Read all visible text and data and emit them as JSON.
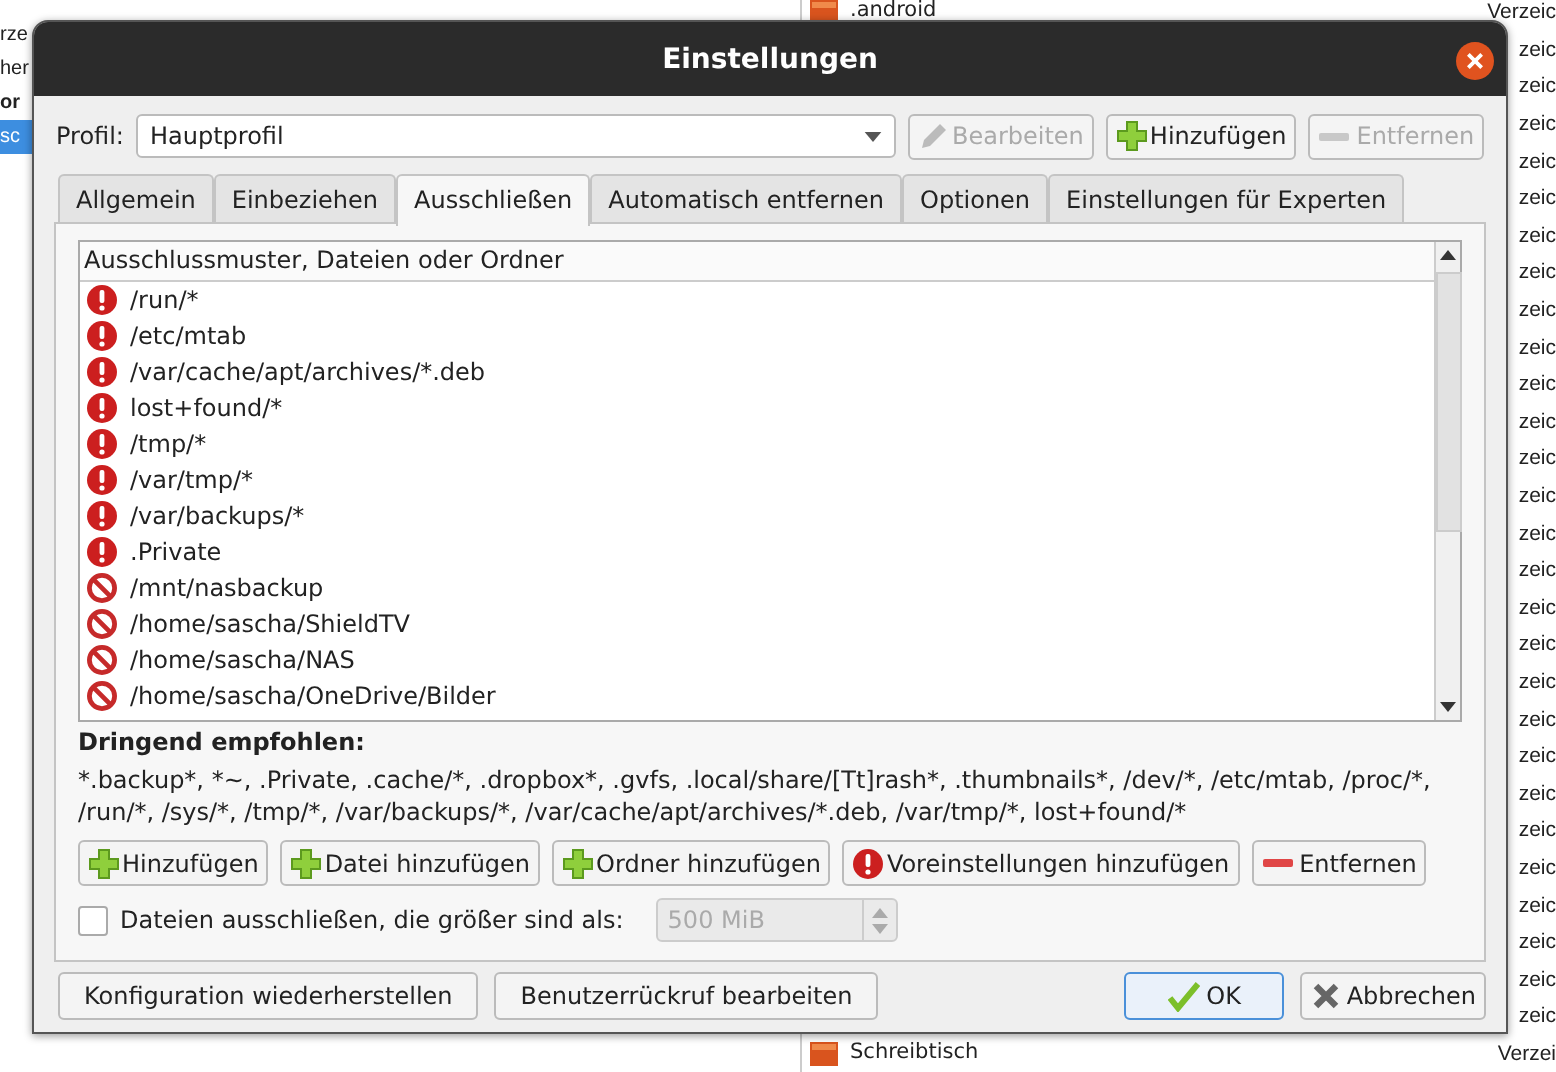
{
  "background": {
    "left_items": [
      {
        "label": "rze",
        "selected": false,
        "bold": false
      },
      {
        "label": "her",
        "selected": false,
        "bold": false
      },
      {
        "label": "or",
        "selected": false,
        "bold": true
      },
      {
        "label": "sc",
        "selected": true,
        "bold": false
      }
    ],
    "rows": [
      {
        "name": ".android",
        "type": "Verzeic"
      },
      {
        "type": "zeic"
      },
      {
        "type": "zeic"
      },
      {
        "type": "zeic"
      },
      {
        "type": "zeic"
      },
      {
        "type": "zeic"
      },
      {
        "type": "zeic"
      },
      {
        "type": "zeic"
      },
      {
        "type": "zeic"
      },
      {
        "type": "zeic"
      },
      {
        "type": "zeic"
      },
      {
        "type": "zeic"
      },
      {
        "type": "zeic"
      },
      {
        "type": "zeic"
      },
      {
        "type": "zeic"
      },
      {
        "type": "zeic"
      },
      {
        "type": "zeic"
      },
      {
        "type": "zeic"
      },
      {
        "type": "zeic"
      },
      {
        "type": "zeic"
      },
      {
        "type": "zeic"
      },
      {
        "type": "zeic"
      },
      {
        "type": "zeic"
      },
      {
        "type": "zeic"
      },
      {
        "type": "zeic"
      },
      {
        "type": "zeic"
      },
      {
        "type": "zeic"
      },
      {
        "type": "zeic"
      },
      {
        "name": "Schreibtisch",
        "type": "Verzei"
      }
    ]
  },
  "window": {
    "title": "Einstellungen"
  },
  "profile": {
    "label": "Profil:",
    "value": "Hauptprofil",
    "buttons": [
      {
        "label": "Bearbeiten",
        "kind": "edit",
        "disabled": true
      },
      {
        "label": "Hinzufügen",
        "kind": "add",
        "disabled": false
      },
      {
        "label": "Entfernen",
        "kind": "remove",
        "disabled": true
      }
    ]
  },
  "tabs": [
    {
      "label": "Allgemein",
      "selected": false
    },
    {
      "label": "Einbeziehen",
      "selected": false
    },
    {
      "label": "Ausschließen",
      "selected": true
    },
    {
      "label": "Automatisch entfernen",
      "selected": false
    },
    {
      "label": "Optionen",
      "selected": false
    },
    {
      "label": "Einstellungen für Experten",
      "selected": false
    }
  ],
  "list": {
    "header": "Ausschlussmuster, Dateien oder Ordner",
    "rows": [
      {
        "kind": "recommended",
        "text": "/run/*"
      },
      {
        "kind": "recommended",
        "text": "/etc/mtab"
      },
      {
        "kind": "recommended",
        "text": "/var/cache/apt/archives/*.deb"
      },
      {
        "kind": "recommended",
        "text": "lost+found/*"
      },
      {
        "kind": "recommended",
        "text": "/tmp/*"
      },
      {
        "kind": "recommended",
        "text": "/var/tmp/*"
      },
      {
        "kind": "recommended",
        "text": "/var/backups/*"
      },
      {
        "kind": "recommended",
        "text": ".Private"
      },
      {
        "kind": "custom",
        "text": "/mnt/nasbackup"
      },
      {
        "kind": "custom",
        "text": "/home/sascha/ShieldTV"
      },
      {
        "kind": "custom",
        "text": "/home/sascha/NAS"
      },
      {
        "kind": "custom",
        "text": "/home/sascha/OneDrive/Bilder"
      }
    ]
  },
  "recommended": {
    "title": "Dringend empfohlen:",
    "text": "*.backup*, *~, .Private, .cache/*, .dropbox*, .gvfs, .local/share/[Tt]rash*, .thumbnails*, /dev/*, /etc/mtab, /proc/*, /run/*, /sys/*, /tmp/*, /var/backups/*, /var/cache/apt/archives/*.deb, /var/tmp/*, lost+found/*"
  },
  "actions": [
    {
      "label": "Hinzufügen",
      "kind": "add"
    },
    {
      "label": "Datei hinzufügen",
      "kind": "add"
    },
    {
      "label": "Ordner hinzufügen",
      "kind": "add"
    },
    {
      "label": "Voreinstellungen hinzufügen",
      "kind": "defaults"
    },
    {
      "label": "Entfernen",
      "kind": "remove"
    }
  ],
  "size_limit": {
    "label": "Dateien ausschließen, die größer sind als:",
    "checked": false,
    "value": "500 MiB"
  },
  "footer": {
    "left": [
      "Konfiguration wiederherstellen",
      "Benutzerrückruf bearbeiten"
    ],
    "ok": "OK",
    "cancel": "Abbrechen"
  }
}
